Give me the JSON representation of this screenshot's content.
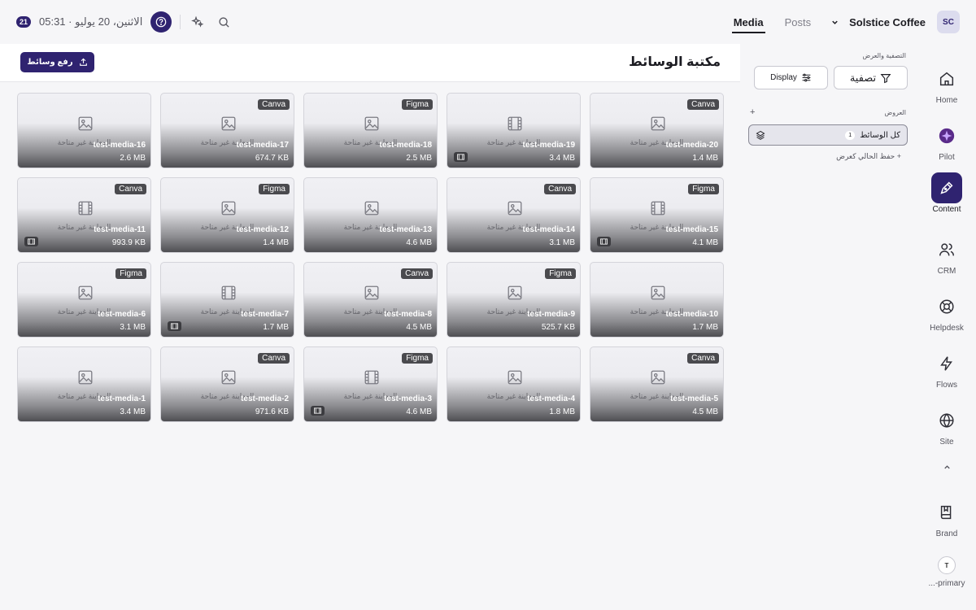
{
  "topbar": {
    "date_badge": "21",
    "date_text": "الاثنين، 20 يوليو · 05:31",
    "tabs": [
      "Media",
      "Posts"
    ],
    "brand": "Solstice Coffee",
    "avatar": "SC"
  },
  "rail": {
    "items": [
      {
        "label": "Home",
        "icon": "home-icon"
      },
      {
        "label": "Pilot",
        "icon": "pilot-icon"
      },
      {
        "label": "Content",
        "icon": "content-icon",
        "active": true
      },
      {
        "label": "CRM",
        "icon": "users-icon"
      },
      {
        "label": "Helpdesk",
        "icon": "lifebuoy-icon"
      },
      {
        "label": "Flows",
        "icon": "bolt-icon"
      },
      {
        "label": "Site",
        "icon": "globe-icon"
      },
      {
        "label": "Brand",
        "icon": "book-icon"
      }
    ],
    "user_initial": "T",
    "user_label": "...-primary"
  },
  "filter_panel": {
    "title": "التصفية والعرض",
    "filter_label": "تصفية",
    "display_label": "Display",
    "views_title": "العروض",
    "views_add": "+",
    "view_name": "كل الوسائط",
    "view_count": "1",
    "save_view": "+ حفظ الحالي كعرض"
  },
  "library": {
    "title": "مكتبة الوسائط",
    "upload_label": "رفع وسائط",
    "unavailable_text": "المعاينة غير متاحة",
    "cards": [
      {
        "name": "test-media-20",
        "size": "1.4 MB",
        "tag": "Canva",
        "type": "image"
      },
      {
        "name": "test-media-19",
        "size": "3.4 MB",
        "tag": "",
        "type": "video"
      },
      {
        "name": "test-media-18",
        "size": "2.5 MB",
        "tag": "Figma",
        "type": "image"
      },
      {
        "name": "test-media-17",
        "size": "674.7 KB",
        "tag": "Canva",
        "type": "image"
      },
      {
        "name": "test-media-16",
        "size": "2.6 MB",
        "tag": "",
        "type": "image"
      },
      {
        "name": "test-media-15",
        "size": "4.1 MB",
        "tag": "Figma",
        "type": "video"
      },
      {
        "name": "test-media-14",
        "size": "3.1 MB",
        "tag": "Canva",
        "type": "image"
      },
      {
        "name": "test-media-13",
        "size": "4.6 MB",
        "tag": "",
        "type": "image"
      },
      {
        "name": "test-media-12",
        "size": "1.4 MB",
        "tag": "Figma",
        "type": "image"
      },
      {
        "name": "test-media-11",
        "size": "993.9 KB",
        "tag": "Canva",
        "type": "video"
      },
      {
        "name": "test-media-10",
        "size": "1.7 MB",
        "tag": "",
        "type": "image"
      },
      {
        "name": "test-media-9",
        "size": "525.7 KB",
        "tag": "Figma",
        "type": "image"
      },
      {
        "name": "test-media-8",
        "size": "4.5 MB",
        "tag": "Canva",
        "type": "image"
      },
      {
        "name": "test-media-7",
        "size": "1.7 MB",
        "tag": "",
        "type": "video"
      },
      {
        "name": "test-media-6",
        "size": "3.1 MB",
        "tag": "Figma",
        "type": "image"
      },
      {
        "name": "test-media-5",
        "size": "4.5 MB",
        "tag": "Canva",
        "type": "image"
      },
      {
        "name": "test-media-4",
        "size": "1.8 MB",
        "tag": "",
        "type": "image"
      },
      {
        "name": "test-media-3",
        "size": "4.6 MB",
        "tag": "Figma",
        "type": "video"
      },
      {
        "name": "test-media-2",
        "size": "971.6 KB",
        "tag": "Canva",
        "type": "image"
      },
      {
        "name": "test-media-1",
        "size": "3.4 MB",
        "tag": "",
        "type": "image"
      }
    ]
  },
  "colors": {
    "accent": "#2f2370",
    "background": "#f6f6f8"
  }
}
